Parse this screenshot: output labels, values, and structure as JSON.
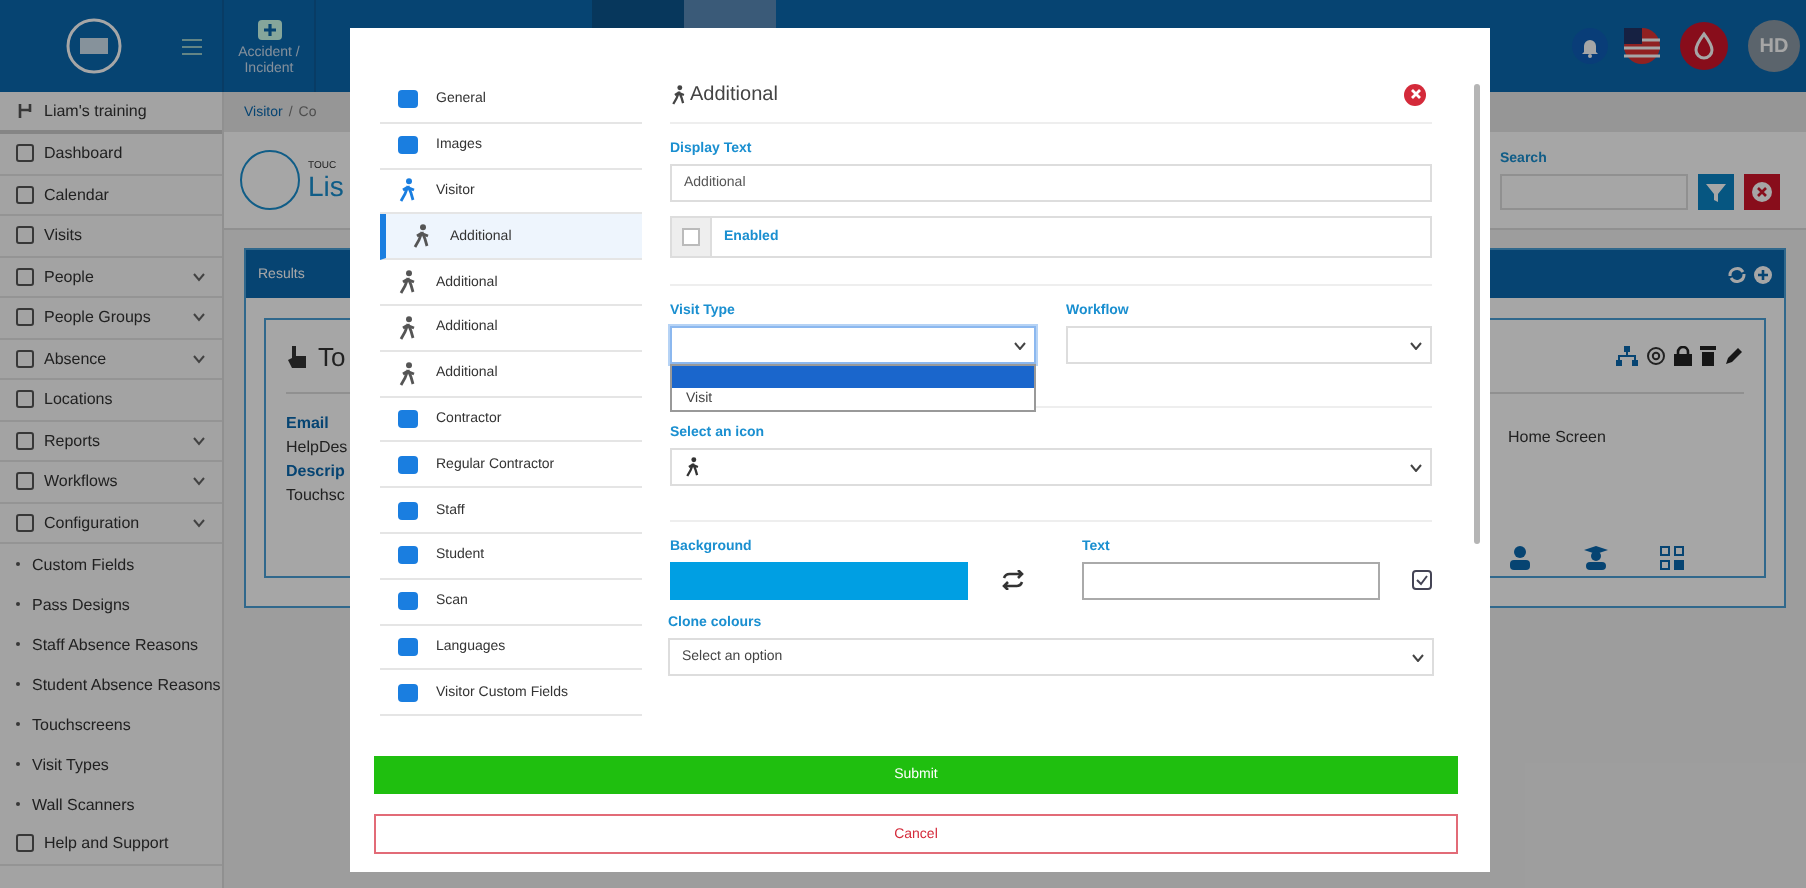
{
  "header": {
    "tiles": [
      {
        "label": "Accident / Incident"
      }
    ],
    "user_initials": "HD"
  },
  "sidebar": {
    "account": "Liam's training",
    "items": [
      {
        "label": "Dashboard",
        "kind": "link"
      },
      {
        "label": "Calendar",
        "kind": "link"
      },
      {
        "label": "Visits",
        "kind": "link"
      },
      {
        "label": "People",
        "kind": "group"
      },
      {
        "label": "People Groups",
        "kind": "group"
      },
      {
        "label": "Absence",
        "kind": "group"
      },
      {
        "label": "Locations",
        "kind": "link"
      },
      {
        "label": "Reports",
        "kind": "group"
      },
      {
        "label": "Workflows",
        "kind": "group"
      },
      {
        "label": "Configuration",
        "kind": "group",
        "expanded": true,
        "children": [
          {
            "label": "Custom Fields"
          },
          {
            "label": "Pass Designs"
          },
          {
            "label": "Staff Absence Reasons"
          },
          {
            "label": "Student Absence Reasons"
          },
          {
            "label": "Touchscreens"
          },
          {
            "label": "Visit Types"
          },
          {
            "label": "Wall Scanners"
          }
        ]
      },
      {
        "label": "Help and Support",
        "kind": "link"
      }
    ]
  },
  "breadcrumb": {
    "items": [
      "Visitor",
      "Co"
    ],
    "separator": "/"
  },
  "page": {
    "subtitle": "TOUC",
    "title": "Lis"
  },
  "search": {
    "label": "Search"
  },
  "results": {
    "title": "Results"
  },
  "card": {
    "title": "To",
    "fields": [
      {
        "label": "Email",
        "value": "HelpDes"
      },
      {
        "label": "Descrip",
        "value": "Touchsc"
      }
    ],
    "column_label": "Home Screen"
  },
  "modal": {
    "nav": [
      {
        "label": "General",
        "selected": false
      },
      {
        "label": "Images",
        "selected": false
      },
      {
        "label": "Visitor",
        "selected": false
      },
      {
        "label": "Additional",
        "selected": true
      },
      {
        "label": "Additional",
        "selected": false
      },
      {
        "label": "Additional",
        "selected": false
      },
      {
        "label": "Additional",
        "selected": false
      },
      {
        "label": "Contractor",
        "selected": false
      },
      {
        "label": "Regular Contractor",
        "selected": false
      },
      {
        "label": "Staff",
        "selected": false
      },
      {
        "label": "Student",
        "selected": false
      },
      {
        "label": "Scan",
        "selected": false
      },
      {
        "label": "Languages",
        "selected": false
      },
      {
        "label": "Visitor Custom Fields",
        "selected": false
      }
    ],
    "heading": "Additional",
    "display_text": {
      "label": "Display Text",
      "value": "Additional"
    },
    "enabled": {
      "label": "Enabled",
      "checked": false
    },
    "visit_type": {
      "label": "Visit Type",
      "open": true,
      "blank_option_highlighted": true,
      "options": [
        {
          "label": "Visit",
          "selected": false
        }
      ]
    },
    "workflow": {
      "label": "Workflow"
    },
    "icon_select": {
      "label": "Select an icon"
    },
    "background": {
      "label": "Background",
      "color": "#009fe3"
    },
    "text_color": {
      "label": "Text"
    },
    "clone": {
      "label": "Clone colours",
      "placeholder": "Select an option"
    },
    "submit": "Submit",
    "cancel": "Cancel"
  }
}
